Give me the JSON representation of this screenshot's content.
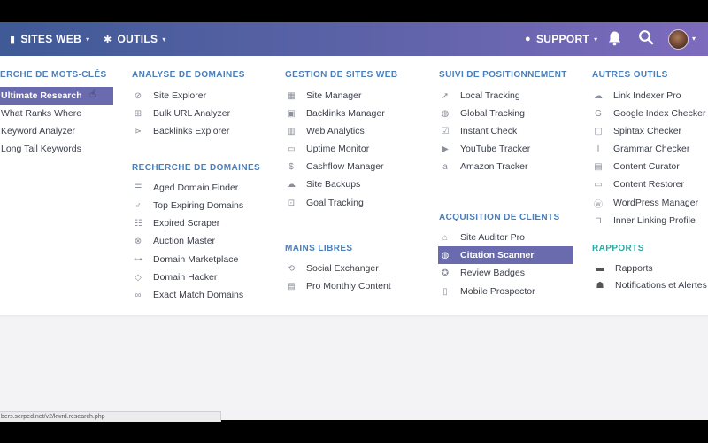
{
  "nav": {
    "sites": "SITES WEB",
    "outils": "OUTILS",
    "support": "SUPPORT"
  },
  "menu": {
    "col1": {
      "title": "ERCHE DE MOTS-CLÉS",
      "items": [
        "Ultimate Research",
        "What Ranks Where",
        "Keyword Analyzer",
        "Long Tail Keywords"
      ]
    },
    "col2": {
      "title1": "ANALYSE DE DOMAINES",
      "items1": [
        "Site Explorer",
        "Bulk URL Analyzer",
        "Backlinks Explorer"
      ],
      "title2": "RECHERCHE DE DOMAINES",
      "items2": [
        "Aged Domain Finder",
        "Top Expiring Domains",
        "Expired Scraper",
        "Auction Master",
        "Domain Marketplace",
        "Domain Hacker",
        "Exact Match Domains"
      ]
    },
    "col3": {
      "title1": "GESTION DE SITES WEB",
      "items1": [
        "Site Manager",
        "Backlinks Manager",
        "Web Analytics",
        "Uptime Monitor",
        "Cashflow Manager",
        "Site Backups",
        "Goal Tracking"
      ],
      "title2": "MAINS LIBRES",
      "items2": [
        "Social Exchanger",
        "Pro Monthly Content"
      ]
    },
    "col4": {
      "title1": "SUIVI DE POSITIONNEMENT",
      "items1": [
        "Local Tracking",
        "Global Tracking",
        "Instant Check",
        "YouTube Tracker",
        "Amazon Tracker"
      ],
      "title2": "ACQUISITION DE CLIENTS",
      "items2": [
        "Site Auditor Pro",
        "Citation Scanner",
        "Review Badges",
        "Mobile Prospector"
      ]
    },
    "col5": {
      "title1": "AUTRES OUTILS",
      "items1": [
        "Link Indexer Pro",
        "Google Index Checker",
        "Spintax Checker",
        "Grammar Checker",
        "Content Curator",
        "Content Restorer",
        "WordPress Manager",
        "Inner Linking Profile"
      ],
      "title2": "RAPPORTS",
      "items2": [
        "Rapports",
        "Notifications et Alertes"
      ]
    }
  },
  "status_url": "bers.serped.net/v2/kwrd.research.php",
  "colors": {
    "nav_start": "#3f5a96",
    "nav_end": "#7d6bbd",
    "active_item": "#6a6aaf",
    "section_title": "#4a7fba",
    "section_title_reports": "#2fa7a0"
  }
}
